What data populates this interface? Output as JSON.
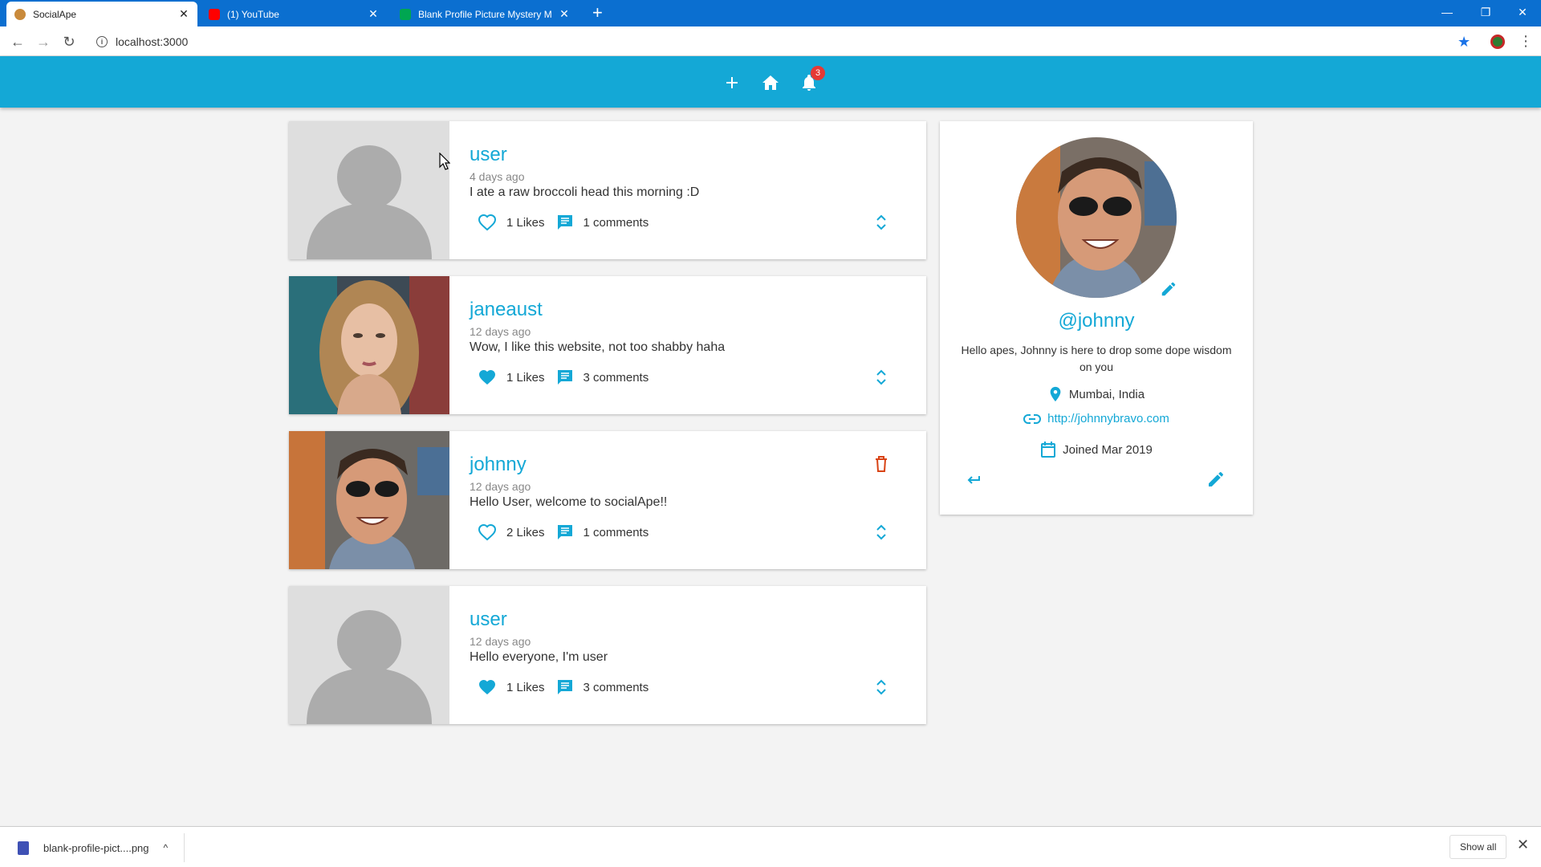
{
  "browser": {
    "tabs": [
      {
        "title": "SocialApe",
        "fav_color": "#c98a3b",
        "active": true
      },
      {
        "title": "(1) YouTube",
        "fav_color": "#ff0000",
        "active": false
      },
      {
        "title": "Blank Profile Picture Mystery Ma",
        "fav_color": "#00a651",
        "active": false
      }
    ],
    "new_tab_glyph": "+",
    "url": "localhost:3000",
    "info_glyph": "i"
  },
  "appbar": {
    "notification_count": "3",
    "accent": "#14a8d6"
  },
  "screams": [
    {
      "user": "user",
      "time": "4 days ago",
      "body": "I ate a raw broccoli head this morning :D",
      "likes": "1 Likes",
      "comments": "1 comments",
      "liked": false,
      "can_delete": false,
      "avatar": "blank"
    },
    {
      "user": "janeaust",
      "time": "12 days ago",
      "body": "Wow, I like this website, not too shabby haha",
      "likes": "1 Likes",
      "comments": "3 comments",
      "liked": true,
      "can_delete": false,
      "avatar": "photo-woman"
    },
    {
      "user": "johnny",
      "time": "12 days ago",
      "body": "Hello User, welcome to socialApe!!",
      "likes": "2 Likes",
      "comments": "1 comments",
      "liked": false,
      "can_delete": true,
      "avatar": "photo-man"
    },
    {
      "user": "user",
      "time": "12 days ago",
      "body": "Hello everyone, I'm user",
      "likes": "1 Likes",
      "comments": "3 comments",
      "liked": true,
      "can_delete": false,
      "avatar": "blank"
    }
  ],
  "profile": {
    "handle": "@johnny",
    "bio": "Hello apes, Johnny is here to drop some dope wisdom on you",
    "location": "Mumbai, India",
    "website": "http://johnnybravo.com",
    "joined": "Joined Mar 2019"
  },
  "downloads": {
    "file": "blank-profile-pict....png",
    "show_all": "Show all"
  }
}
